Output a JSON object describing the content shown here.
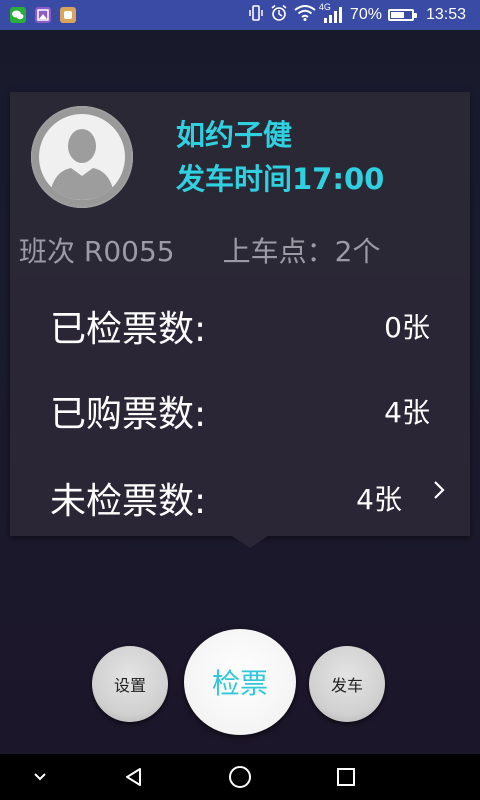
{
  "status_bar": {
    "signal_tag": "4G",
    "battery": "70%",
    "battery_level": 0.7,
    "time": "13:53",
    "icons": [
      "wechat-icon",
      "gallery-icon",
      "app-icon",
      "vibrate-icon",
      "alarm-icon",
      "wifi-icon",
      "signal-icon",
      "battery-icon"
    ]
  },
  "driver": {
    "name": "如约子健",
    "departure_time": "发车时间17:00",
    "avatar_icon": "avatar-placeholder-icon"
  },
  "trip": {
    "shift": "班次 R0055",
    "pickup_points": "上车点：2个"
  },
  "tickets": {
    "checked_label": "已检票数:",
    "checked_value": "0张",
    "purchased_label": "已购票数:",
    "purchased_value": "4张",
    "unchecked_label": "未检票数:",
    "unchecked_value": "4张"
  },
  "actions": {
    "settings": "设置",
    "check_ticket": "检票",
    "depart": "发车"
  },
  "nav": {
    "icons": [
      "chevron-down-icon",
      "back-icon",
      "home-icon",
      "recents-icon"
    ]
  },
  "colors": {
    "accent": "#2fd1e0",
    "status_bar": "#3a4ba6",
    "card": "#2a2636"
  }
}
